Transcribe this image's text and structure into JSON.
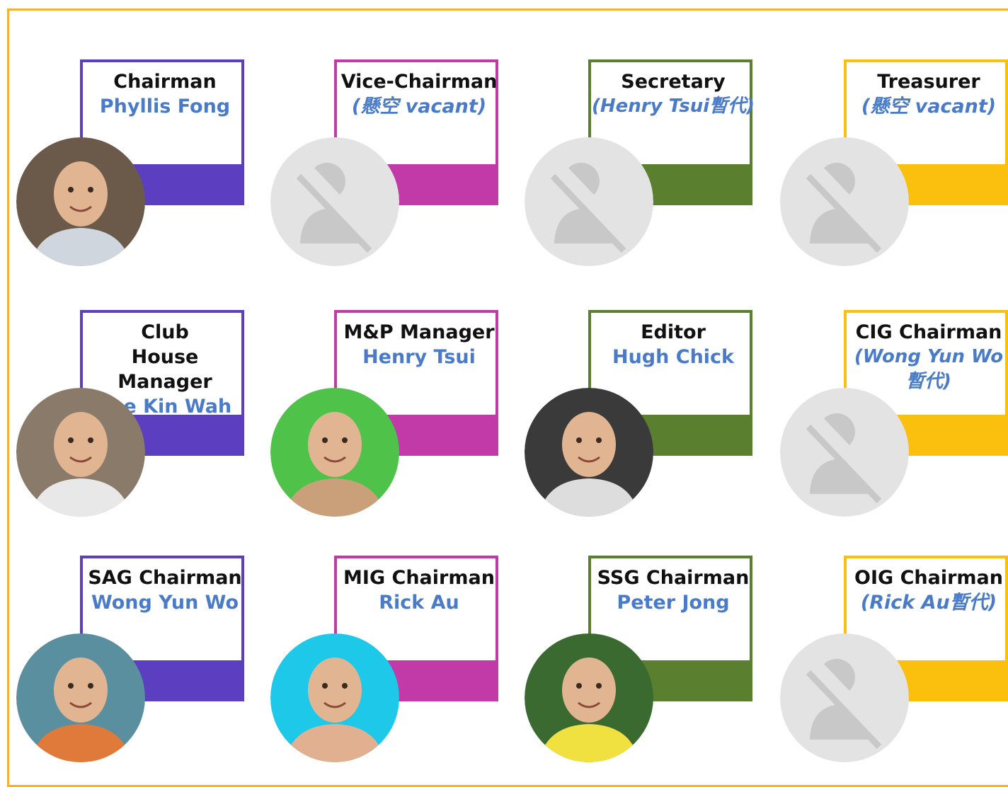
{
  "colors": {
    "frame": "#f2b233",
    "purple": "#5b3fc0",
    "magenta": "#c23aa8",
    "green": "#5a7f2f",
    "yellow": "#fbbf0e",
    "name_blue": "#4a7bc8",
    "placeholder_gray": "#e3e3e3"
  },
  "cards": [
    {
      "title": "Chairman",
      "name": "Phyllis Fong",
      "vacant": false,
      "color": "purple",
      "photo": "photo-person"
    },
    {
      "title": "Vice-Chairman",
      "name": "(懸空 vacant)",
      "vacant": true,
      "color": "magenta",
      "photo": "no-photo-icon"
    },
    {
      "title": "Secretary",
      "name": "(Henry Tsui暫代)",
      "vacant": true,
      "color": "green",
      "photo": "no-photo-icon"
    },
    {
      "title": "Treasurer",
      "name": "(懸空 vacant)",
      "vacant": true,
      "color": "yellow",
      "photo": "no-photo-icon"
    },
    {
      "title": "Club House Manager",
      "name": "Lee Kin Wah",
      "vacant": false,
      "color": "purple",
      "photo": "photo-person"
    },
    {
      "title": "M&P Manager",
      "name": "Henry Tsui",
      "vacant": false,
      "color": "magenta",
      "photo": "photo-person"
    },
    {
      "title": "Editor",
      "name": "Hugh Chick",
      "vacant": false,
      "color": "green",
      "photo": "photo-person"
    },
    {
      "title": "CIG Chairman",
      "name": "(Wong Yun Wo 暫代)",
      "vacant": true,
      "color": "yellow",
      "photo": "no-photo-icon"
    },
    {
      "title": "SAG Chairman",
      "name": "Wong Yun Wo",
      "vacant": false,
      "color": "purple",
      "photo": "photo-person"
    },
    {
      "title": "MIG Chairman",
      "name": "Rick Au",
      "vacant": false,
      "color": "magenta",
      "photo": "photo-person"
    },
    {
      "title": "SSG Chairman",
      "name": "Peter Jong",
      "vacant": false,
      "color": "green",
      "photo": "photo-person"
    },
    {
      "title": "OIG Chairman",
      "name": "(Rick Au暫代)",
      "vacant": true,
      "color": "yellow",
      "photo": "no-photo-icon"
    }
  ]
}
